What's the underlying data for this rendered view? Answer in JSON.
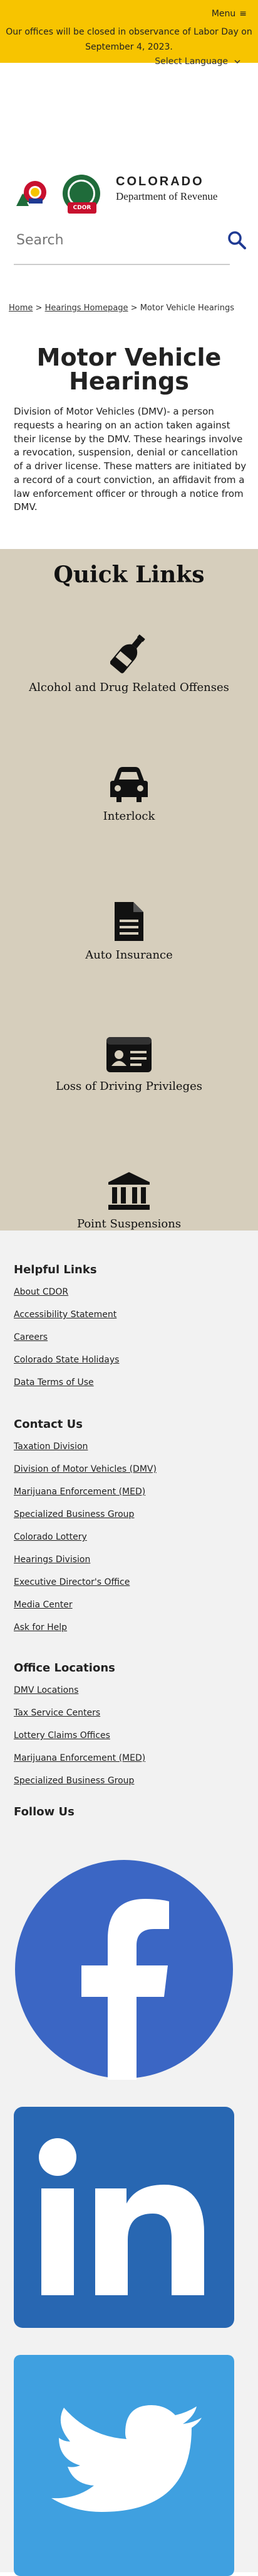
{
  "header": {
    "menu_label": "Menu",
    "alert": "Our offices will be closed in observance of Labor Day on September 4, 2023."
  },
  "language": {
    "label": "Select Language"
  },
  "logo": {
    "line1": "COLORADO",
    "line2": "Department of Revenue",
    "badge": "CDOR"
  },
  "search": {
    "placeholder": "Search"
  },
  "breadcrumb": {
    "home": "Home",
    "sep1": ">",
    "hearings": "Hearings Homepage",
    "sep2": ">",
    "current": "Motor Vehicle Hearings"
  },
  "page": {
    "title_line1": "Motor Vehicle",
    "title_line2": "Hearings",
    "intro": "Division of Motor Vehicles (DMV)- a person requests a hearing on an action taken against their license by the DMV. These hearings involve a revocation, suspension, denial or cancellation of a driver license. These matters are initiated by a record of a court conviction, an affidavit from a law enforcement officer or through a notice from DMV."
  },
  "quick_links": {
    "title": "Quick Links",
    "items": [
      {
        "label": "Alcohol and Drug Related Offenses",
        "icon": "bottle-icon"
      },
      {
        "label": "Interlock",
        "icon": "car-icon"
      },
      {
        "label": "Auto Insurance",
        "icon": "document-icon"
      },
      {
        "label": "Loss of Driving Privileges",
        "icon": "id-card-icon"
      },
      {
        "label": "Point Suspensions",
        "icon": "courthouse-icon"
      }
    ]
  },
  "footer": {
    "helpful": {
      "title": "Helpful Links",
      "links": [
        "About CDOR",
        "Accessibility Statement",
        "Careers",
        "Colorado State Holidays",
        "Data Terms of Use"
      ]
    },
    "contact": {
      "title": "Contact Us",
      "links": [
        "Taxation Division",
        "Division of Motor Vehicles (DMV)",
        "Marijuana Enforcement (MED)",
        "Specialized Business Group",
        "Colorado Lottery",
        "Hearings Division",
        "Executive Director's Office",
        "Media Center",
        "Ask for Help"
      ]
    },
    "offices": {
      "title": "Office Locations",
      "links": [
        "DMV Locations",
        "Tax Service Centers",
        "Lottery Claims Offices",
        "Marijuana Enforcement (MED)",
        "Specialized Business Group"
      ]
    },
    "follow": {
      "title": "Follow Us",
      "networks": [
        "facebook-icon",
        "linkedin-icon",
        "twitter-icon"
      ]
    }
  },
  "colors": {
    "alert_bg": "#f7c400",
    "quick_links_bg": "#d6cebc",
    "footer_bg": "#f2f2f2",
    "search_icon": "#1f3a93",
    "facebook": "#3b66c4",
    "linkedin": "#2867b2",
    "twitter": "#3fa0e0"
  }
}
